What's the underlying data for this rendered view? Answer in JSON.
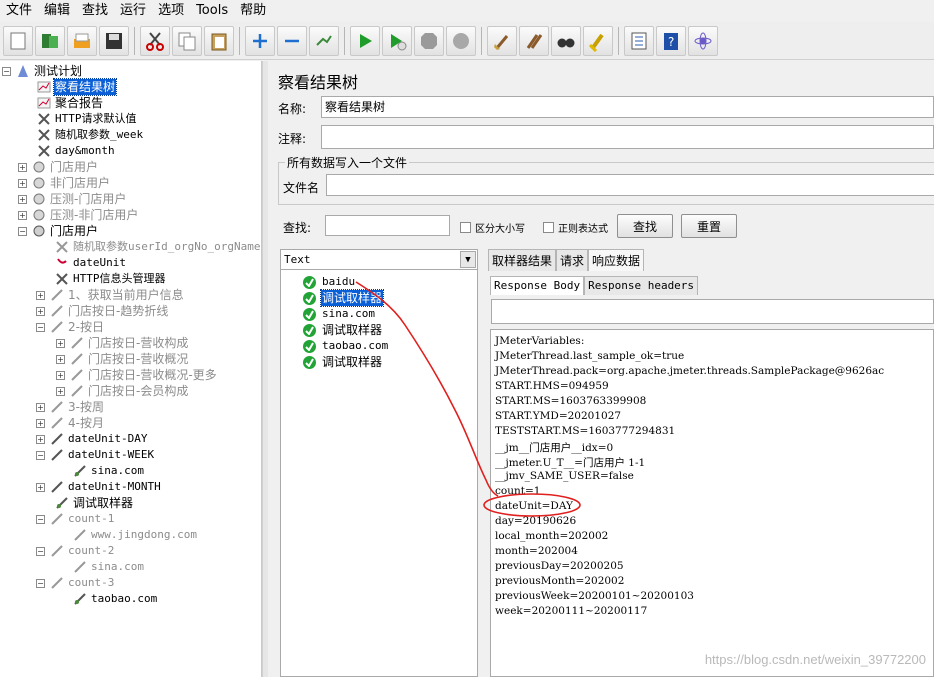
{
  "menu": [
    "文件",
    "编辑",
    "查找",
    "运行",
    "选项",
    "Tools",
    "帮助"
  ],
  "toolbar_icons": [
    "new-icon",
    "templates-icon",
    "open-icon",
    "save-icon",
    "cut-icon",
    "copy-icon",
    "paste-icon",
    "expand-icon",
    "collapse-icon",
    "toggle-icon",
    "start-icon",
    "start-no-pause-icon",
    "stop-icon",
    "shutdown-icon",
    "clear-icon",
    "clear-all-icon",
    "search-binoculars-icon",
    "reset-search-icon",
    "function-helper-icon",
    "help-icon",
    "remote-icon"
  ],
  "tree": {
    "items": [
      {
        "label": "测试计划",
        "icon": "test-plan-icon"
      },
      {
        "label": "察看结果树",
        "icon": "listener-icon"
      },
      {
        "label": "聚合报告",
        "icon": "listener-icon"
      },
      {
        "label": "HTTP请求默认值",
        "icon": "config-icon"
      },
      {
        "label": "随机取参数_week",
        "icon": "config-icon"
      },
      {
        "label": "day&month",
        "icon": "config-icon"
      },
      {
        "label": "门店用户",
        "icon": "thread-group-icon"
      },
      {
        "label": "非门店用户",
        "icon": "thread-group-icon"
      },
      {
        "label": "压测-门店用户",
        "icon": "thread-group-icon"
      },
      {
        "label": "压测-非门店用户",
        "icon": "thread-group-icon"
      },
      {
        "label": "门店用户",
        "icon": "thread-group-icon"
      },
      {
        "label": "随机取参数userId_orgNo_orgName",
        "icon": "config-icon"
      },
      {
        "label": "dateUnit",
        "icon": "config-icon"
      },
      {
        "label": "HTTP信息头管理器",
        "icon": "config-icon"
      },
      {
        "label": "1、获取当前用户信息",
        "icon": "controller-icon"
      },
      {
        "label": "门店按日-趋势折线",
        "icon": "controller-icon"
      },
      {
        "label": "2-按日",
        "icon": "controller-icon"
      },
      {
        "label": "门店按日-营收构成",
        "icon": "controller-icon"
      },
      {
        "label": "门店按日-营收概况",
        "icon": "controller-icon"
      },
      {
        "label": "门店按日-营收概况-更多",
        "icon": "controller-icon"
      },
      {
        "label": "门店按日-会员构成",
        "icon": "controller-icon"
      },
      {
        "label": "3-按周",
        "icon": "controller-icon"
      },
      {
        "label": "4-按月",
        "icon": "controller-icon"
      },
      {
        "label": "dateUnit-DAY",
        "icon": "sampler-icon"
      },
      {
        "label": "dateUnit-WEEK",
        "icon": "sampler-icon"
      },
      {
        "label": "sina.com",
        "icon": "sampler-icon"
      },
      {
        "label": "dateUnit-MONTH",
        "icon": "sampler-icon"
      },
      {
        "label": "调试取样器",
        "icon": "sampler-icon"
      },
      {
        "label": "count-1",
        "icon": "sampler-icon"
      },
      {
        "label": "www.jingdong.com",
        "icon": "sampler-icon"
      },
      {
        "label": "count-2",
        "icon": "sampler-icon"
      },
      {
        "label": "sina.com",
        "icon": "sampler-icon"
      },
      {
        "label": "count-3",
        "icon": "sampler-icon"
      },
      {
        "label": "taobao.com",
        "icon": "sampler-icon"
      }
    ]
  },
  "panel": {
    "title": "察看结果树",
    "name_label": "名称:",
    "name_value": "察看结果树",
    "comment_label": "注释:",
    "comment_value": "",
    "file_group_title": "所有数据写入一个文件",
    "filename_label": "文件名",
    "filename_value": "",
    "search_label": "查找:",
    "search_value": "",
    "case_sensitive_label": "区分大小写",
    "regex_label": "正则表达式",
    "find_button": "查找",
    "reset_button": "重置"
  },
  "results": {
    "renderer": "Text",
    "items": [
      "baidu",
      "调试取样器",
      "sina.com",
      "调试取样器",
      "taobao.com",
      "调试取样器"
    ],
    "selected_index": 1
  },
  "detail": {
    "tabs": [
      "取样器结果",
      "请求",
      "响应数据"
    ],
    "active_tab": 2,
    "subtabs": [
      "Response Body",
      "Response headers"
    ],
    "active_subtab": 0,
    "search_value": "",
    "lines": [
      "JMeterVariables:",
      "JMeterThread.last_sample_ok=true",
      "JMeterThread.pack=org.apache.jmeter.threads.SamplePackage@9626ac",
      "START.HMS=094959",
      "START.MS=1603763399908",
      "START.YMD=20201027",
      "TESTSTART.MS=1603777294831",
      "__jm__门店用户__idx=0",
      "__jmeter.U_T__=门店用户 1-1",
      "__jmv_SAME_USER=false",
      "count=1",
      "dateUnit=DAY",
      "day=20190626",
      "local_month=202002",
      "month=202004",
      "previousDay=20200205",
      "previousMonth=202002",
      "previousWeek=20200101~20200103",
      "week=20200111~20200117"
    ]
  },
  "watermark": "https://blog.csdn.net/weixin_39772200",
  "annotation_color": "#e0201e"
}
